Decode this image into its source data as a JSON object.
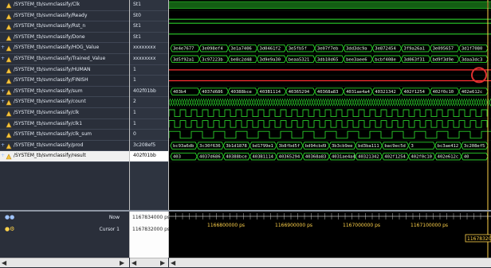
{
  "signals": [
    {
      "name": "/SYSTEM_tb/svmclassify/Clk",
      "value": "St1",
      "kind": "bit",
      "expandable": false
    },
    {
      "name": "/SYSTEM_tb/svmclassify/Ready",
      "value": "St0",
      "kind": "bit",
      "expandable": false
    },
    {
      "name": "/SYSTEM_tb/svmclassify/Rst_n",
      "value": "St1",
      "kind": "bit",
      "expandable": false
    },
    {
      "name": "/SYSTEM_tb/svmclassify/Done",
      "value": "St1",
      "kind": "bit",
      "expandable": false
    },
    {
      "name": "/SYSTEM_tb/svmclassify/HOG_Value",
      "value": "xxxxxxxx",
      "kind": "bus",
      "expandable": true
    },
    {
      "name": "/SYSTEM_tb/svmclassify/Trained_Value",
      "value": "xxxxxxxx",
      "kind": "bus",
      "expandable": true
    },
    {
      "name": "/SYSTEM_tb/svmclassify/HUMAN",
      "value": "1",
      "kind": "line-red",
      "expandable": false
    },
    {
      "name": "/SYSTEM_tb/svmclassify/FINISH",
      "value": "1",
      "kind": "line-red",
      "expandable": false
    },
    {
      "name": "/SYSTEM_tb/svmclassify/sum",
      "value": "402f01bb",
      "kind": "bus",
      "expandable": true
    },
    {
      "name": "/SYSTEM_tb/svmclassify/count",
      "value": "2",
      "kind": "dense",
      "expandable": true
    },
    {
      "name": "/SYSTEM_tb/svmclassify/clk",
      "value": "1",
      "kind": "clock",
      "expandable": false
    },
    {
      "name": "/SYSTEM_tb/svmclassify/clk1",
      "value": "1",
      "kind": "clock",
      "expandable": false
    },
    {
      "name": "/SYSTEM_tb/svmclassify/clk_sum",
      "value": "0",
      "kind": "clock",
      "expandable": false
    },
    {
      "name": "/SYSTEM_tb/svmclassify/prod",
      "value": "3c208ef5",
      "kind": "bus",
      "expandable": true
    },
    {
      "name": "/SYSTEM_tb/svmclassify/result",
      "value": "402f01bb",
      "kind": "bus",
      "expandable": true,
      "selected": true
    }
  ],
  "bus_values": {
    "HOG_Value": [
      "3e4e7677",
      "3e098ef4",
      "3e1a7406",
      "3d0461f2",
      "3e5fb5f",
      "3e07f7eb",
      "3dd3dc9a",
      "3e872454",
      "3f9a26a1",
      "3e095657",
      "3d1f7080"
    ],
    "Trained_Value": [
      "3d5f92a1",
      "3c97223b",
      "be8c2d48",
      "3d9e9a30",
      "beaa5321",
      "3db10d65",
      "bee3aee6",
      "bcbf408e",
      "3d063f31",
      "bd9f3d9e",
      "3daa3dc3"
    ],
    "sum": [
      "403b4",
      "4037d686",
      "40388bce",
      "403B1114",
      "40365294",
      "40368a83",
      "4031ae4a4",
      "40321342",
      "402f1254",
      "402f0c10",
      "402e612c"
    ],
    "prod": [
      "bc93a6db",
      "3c30f636",
      "3b1d1878",
      "bd1799e1",
      "3b8fbd5f",
      "bd94cbd9",
      "3b3cb9ee",
      "bd3ba111",
      "bac9ec5d",
      "3",
      "bc3ae412",
      "3c208ef5"
    ],
    "result": [
      "403",
      "4037d686",
      "40388bce",
      "403B1114",
      "40365294",
      "40368a83",
      "4031ae4a4",
      "40321342",
      "402f1254",
      "402f0c10",
      "402e612c",
      "40"
    ]
  },
  "bottom": {
    "now_label": "Now",
    "now_value": "1167834000 ps",
    "cursor_label": "Cursor 1",
    "cursor_value": "1167832000 ps",
    "ticks": [
      "1166800000 ps",
      "1166900000 ps",
      "1167000000 ps",
      "1167100000 ps"
    ],
    "cursor_time_label": "1167832000 ps"
  },
  "colors": {
    "wave": "#2bd12b",
    "red_line": "#ff3030",
    "cursor": "#ffd24a",
    "highlight_circle": "#e03030"
  }
}
